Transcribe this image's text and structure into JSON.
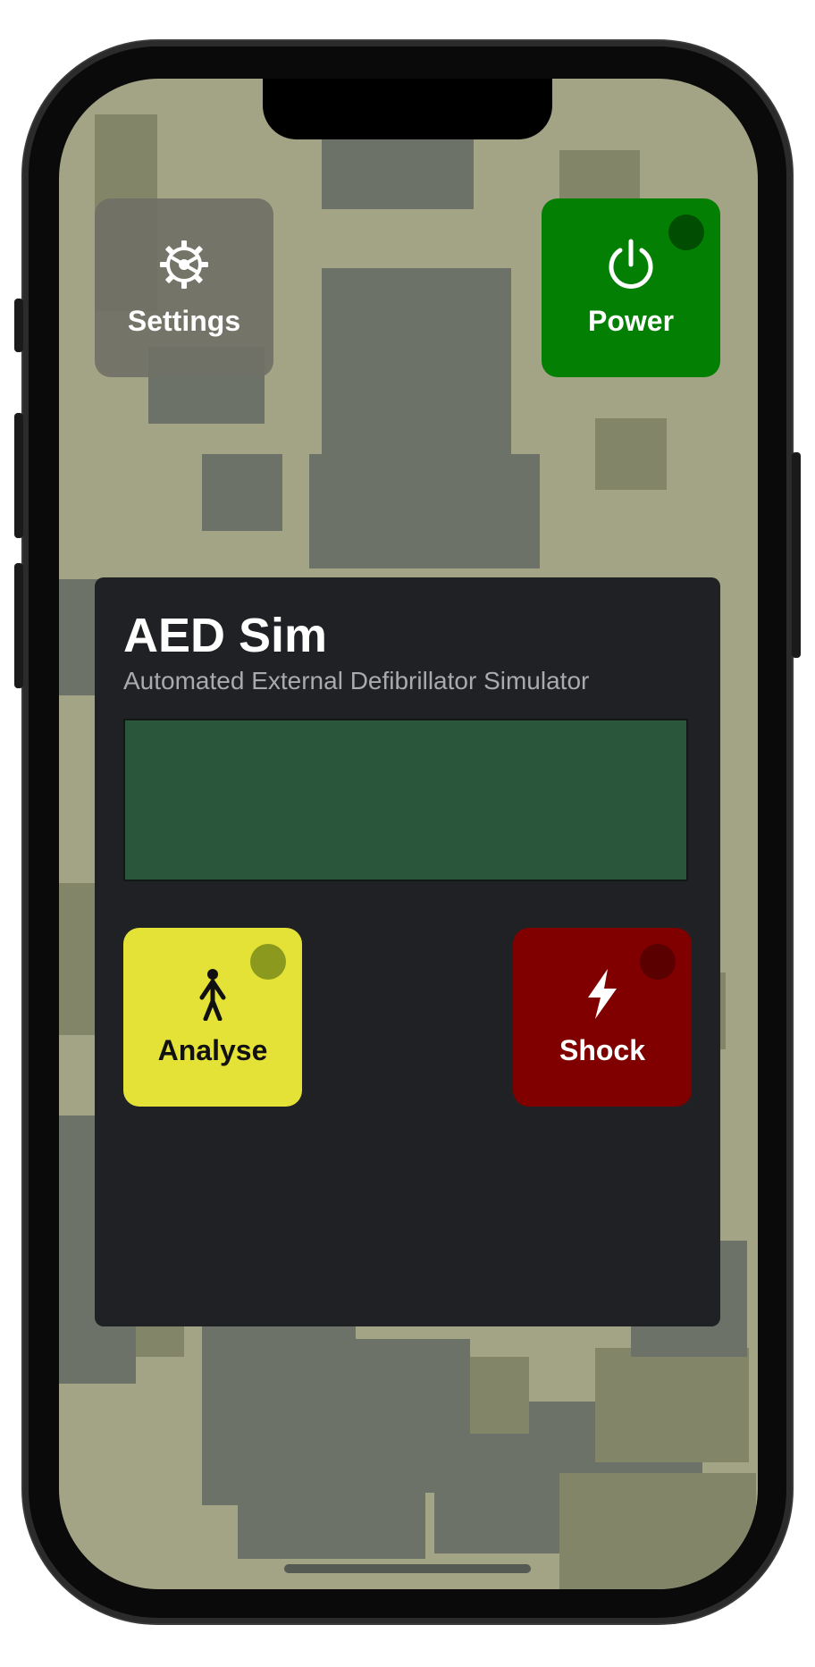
{
  "top_controls": {
    "settings_label": "Settings",
    "settings_icon": "gear-icon",
    "power_label": "Power",
    "power_icon": "power-icon",
    "power_color": "#038004",
    "power_led_color": "#014d02"
  },
  "panel": {
    "title": "AED Sim",
    "subtitle": "Automated External Defibrillator Simulator",
    "display_color": "#2a563b"
  },
  "actions": {
    "analyse_label": "Analyse",
    "analyse_icon": "person-icon",
    "analyse_color": "#e4e236",
    "analyse_led_color": "#8b9a1f",
    "shock_label": "Shock",
    "shock_icon": "lightning-bolt-icon",
    "shock_color": "#800000",
    "shock_led_color": "#5a0000"
  }
}
